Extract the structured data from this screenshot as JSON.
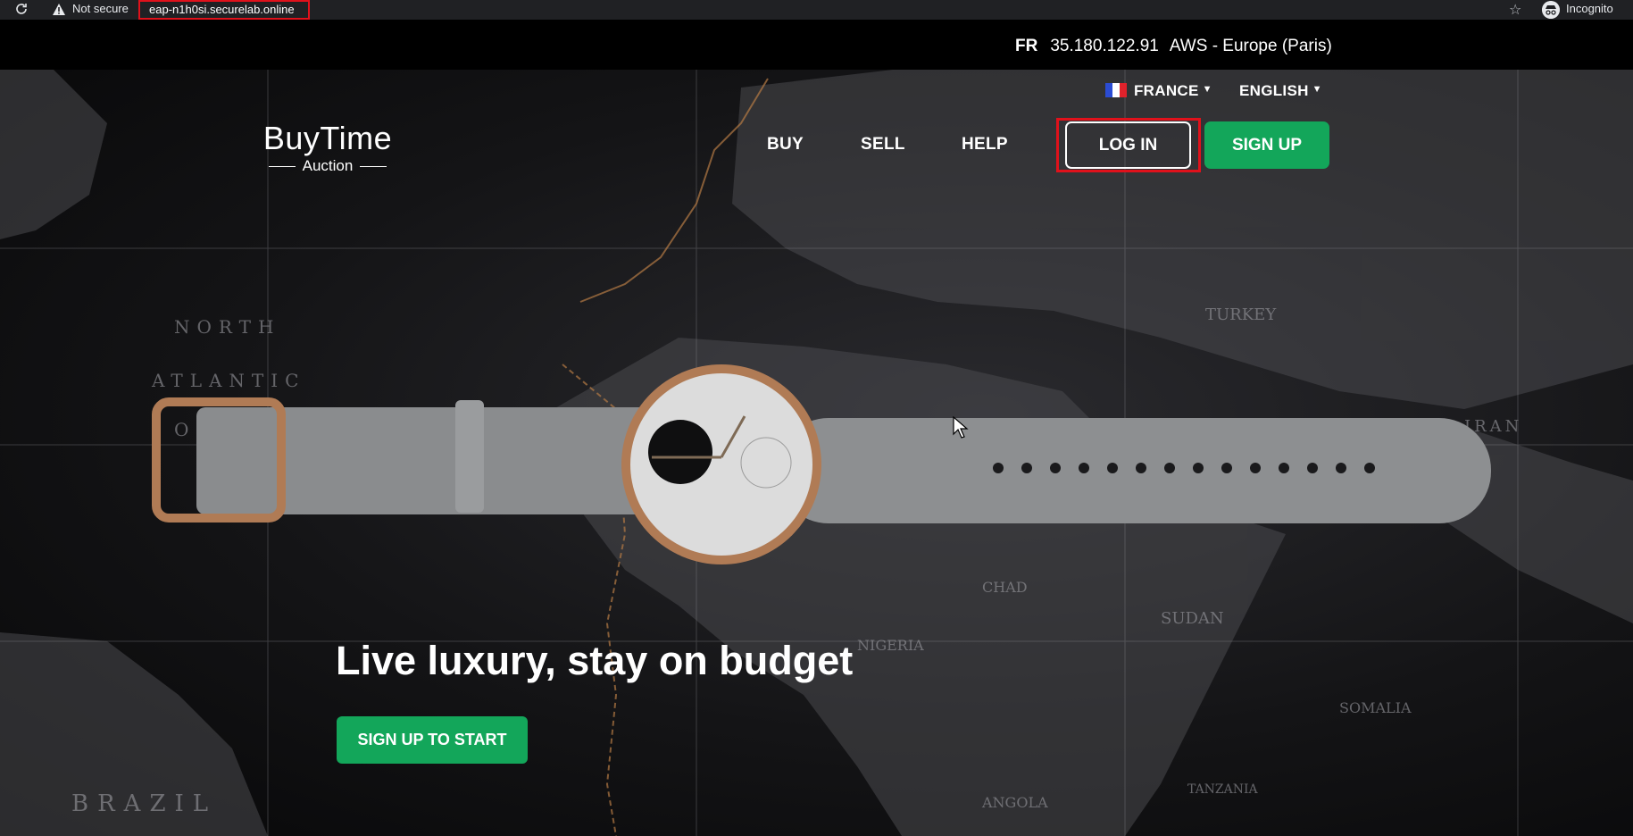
{
  "browser": {
    "security_label": "Not secure",
    "url": "eap-n1h0si.securelab.online",
    "profile_label": "Incognito",
    "icons": [
      "reload-icon",
      "warning-icon",
      "star-icon",
      "incognito-icon"
    ]
  },
  "location_bar": {
    "country_code": "FR",
    "ip": "35.180.122.91",
    "region": "AWS - Europe (Paris)"
  },
  "header": {
    "country_select": "FRANCE",
    "language_select": "ENGLISH",
    "logo_title": "BuyTime",
    "logo_subtitle": "Auction",
    "nav": {
      "buy": "BUY",
      "sell": "SELL",
      "help": "HELP"
    },
    "login_label": "LOG IN",
    "signup_label": "SIGN UP"
  },
  "hero": {
    "headline": "Live luxury, stay on budget",
    "cta_label": "SIGN UP TO START"
  },
  "colors": {
    "accent_green": "#13a65a",
    "highlight_red": "#e0111b",
    "topbar": "#000000"
  }
}
